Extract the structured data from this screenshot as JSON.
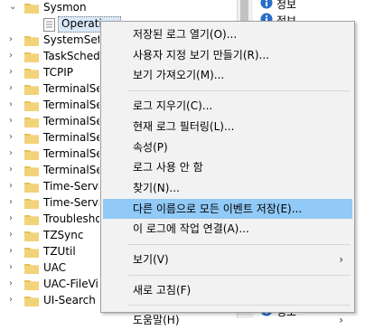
{
  "tree": {
    "parent": "Sysmon",
    "child": "Operational",
    "items": [
      "SystemSettings",
      "TaskScheduler",
      "TCPIP",
      "TerminalServices-ClientUSBDevices",
      "TerminalServices-LocalSessionManager",
      "TerminalServices-PnPDevices",
      "TerminalServices-Printers",
      "TerminalServices-RemoteConnectionManager",
      "TerminalServices-SessionBroker-Client",
      "Time-Service",
      "Time-Service-PTP-Provider",
      "Troubleshooting-Recommended",
      "TZSync",
      "TZUtil",
      "UAC",
      "UAC-FileVirtualization",
      "UI-Search"
    ]
  },
  "right_panel": {
    "rows": [
      "정보",
      "정보",
      "정보",
      "정보"
    ]
  },
  "context_menu": {
    "groups": [
      [
        {
          "label": "저장된 로그 열기(O)..."
        },
        {
          "label": "사용자 지정 보기 만들기(R)..."
        },
        {
          "label": "보기 가져오기(M)..."
        }
      ],
      [
        {
          "label": "로그 지우기(C)..."
        },
        {
          "label": "현재 로그 필터링(L)..."
        },
        {
          "label": "속성(P)"
        },
        {
          "label": "로그 사용 안 함"
        },
        {
          "label": "찾기(N)..."
        },
        {
          "label": "다른 이름으로 모든 이벤트 저장(E)...",
          "highlighted": true
        },
        {
          "label": "이 로그에 작업 연결(A)..."
        }
      ],
      [
        {
          "label": "보기(V)",
          "submenu": true
        }
      ],
      [
        {
          "label": "새로 고침(F)"
        }
      ],
      [
        {
          "label": "도움말(H)",
          "submenu": true
        }
      ]
    ]
  },
  "colors": {
    "highlight": "#91c9f7",
    "folder": "#e8c156",
    "info_icon": "#2a6fc9"
  }
}
